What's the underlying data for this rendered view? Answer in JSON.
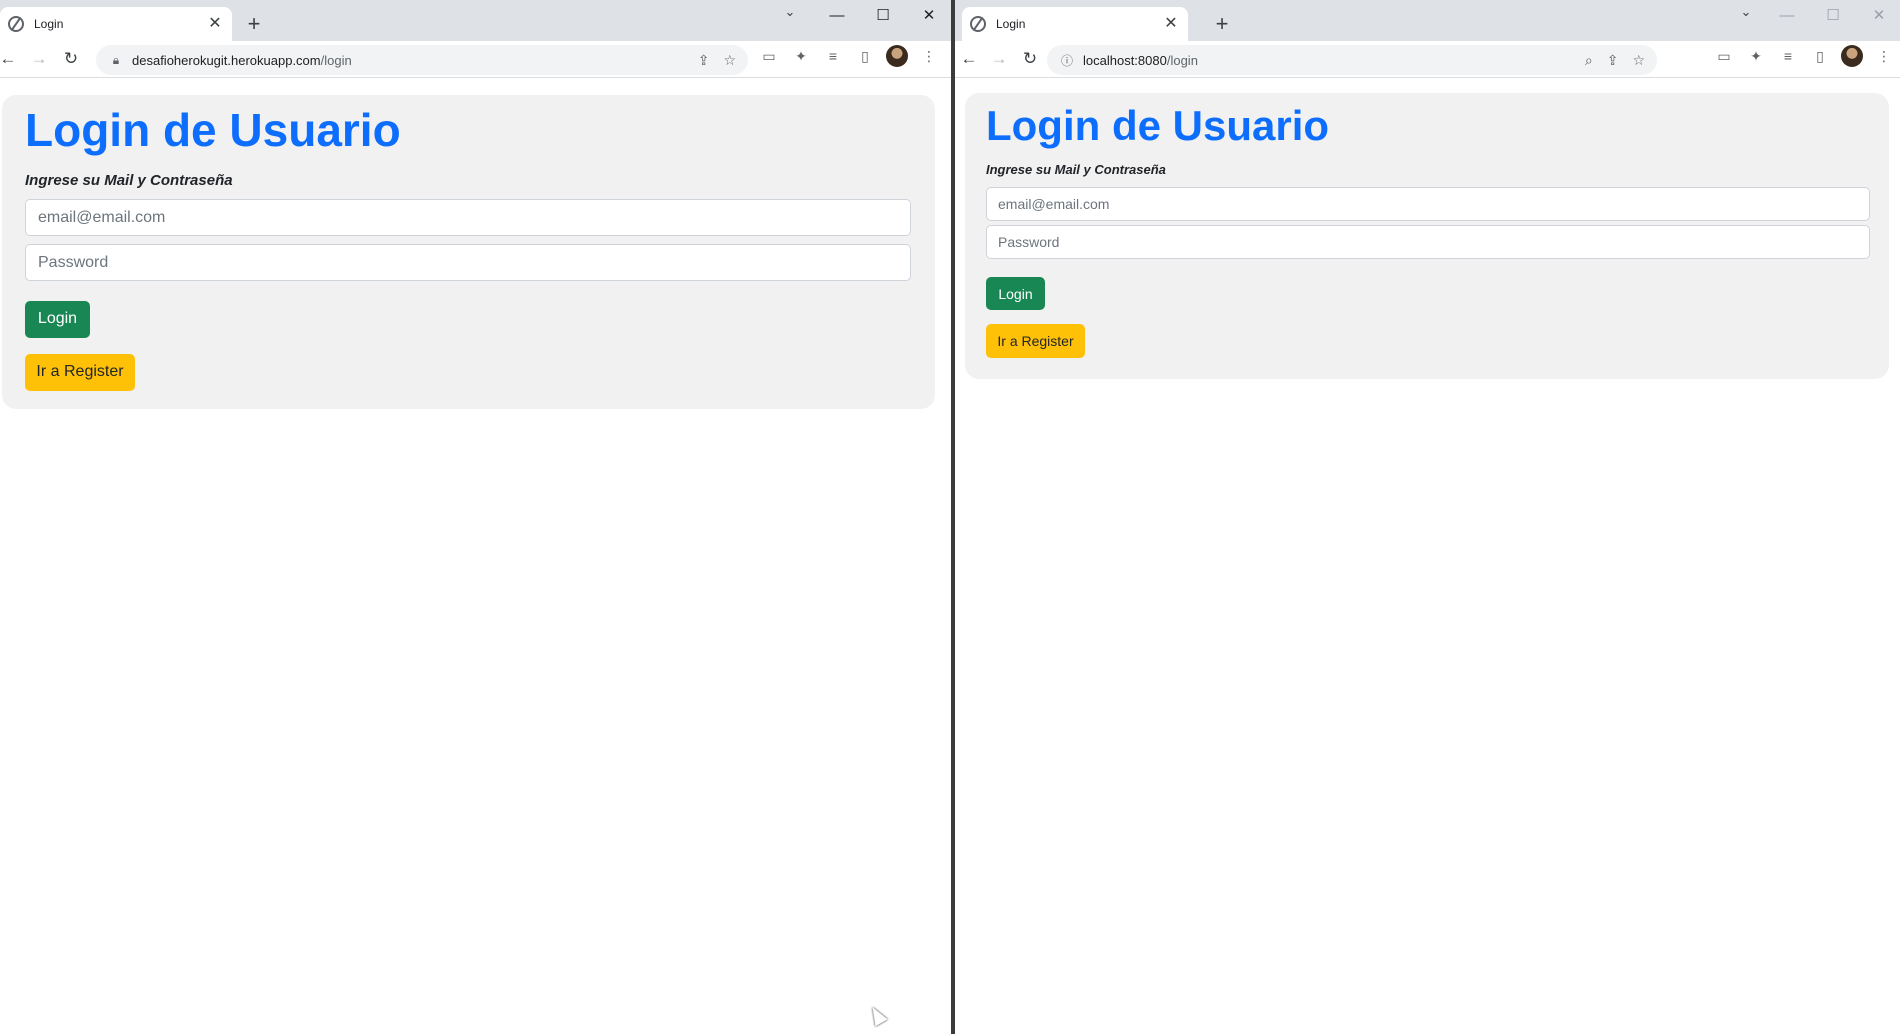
{
  "windows": {
    "left": {
      "tab": {
        "title": "Login",
        "close": "✕"
      },
      "new_tab": "+",
      "dropdown": "⌄",
      "controls": {
        "minimize": "—",
        "maximize": "☐",
        "close": "✕"
      },
      "nav": {
        "back": "←",
        "forward": "→",
        "reload": "↻"
      },
      "omnibox": {
        "security_icon": "lock-icon",
        "host": "desafioherokugit.herokuapp.com",
        "path": "/login",
        "share": "⇪",
        "star": "☆"
      },
      "toolbar_icons": {
        "cast": "▭",
        "extensions": "✦",
        "media": "≡",
        "sidepanel": "▯",
        "menu": "⋮"
      },
      "page": {
        "title": "Login de Usuario",
        "subtitle": "Ingrese su Mail y Contraseña",
        "email_placeholder": "email@email.com",
        "password_placeholder": "Password",
        "login_button": "Login",
        "register_button": "Ir a Register"
      }
    },
    "right": {
      "tab": {
        "title": "Login",
        "close": "✕"
      },
      "new_tab": "+",
      "dropdown": "⌄",
      "controls": {
        "minimize": "—",
        "maximize": "☐",
        "close": "✕"
      },
      "nav": {
        "back": "←",
        "forward": "→",
        "reload": "↻"
      },
      "omnibox": {
        "security_icon": "info-icon",
        "host": "localhost:8080",
        "path": "/login",
        "zoom": "⌕",
        "share": "⇪",
        "star": "☆"
      },
      "toolbar_icons": {
        "cast": "▭",
        "extensions": "✦",
        "media": "≡",
        "sidepanel": "▯",
        "menu": "⋮"
      },
      "page": {
        "title": "Login de Usuario",
        "subtitle": "Ingrese su Mail y Contraseña",
        "email_placeholder": "email@email.com",
        "password_placeholder": "Password",
        "login_button": "Login",
        "register_button": "Ir a Register"
      }
    }
  },
  "colors": {
    "title_blue": "#0d6efd",
    "login_green": "#198754",
    "register_yellow": "#ffc107",
    "card_gray": "#f1f1f1"
  }
}
